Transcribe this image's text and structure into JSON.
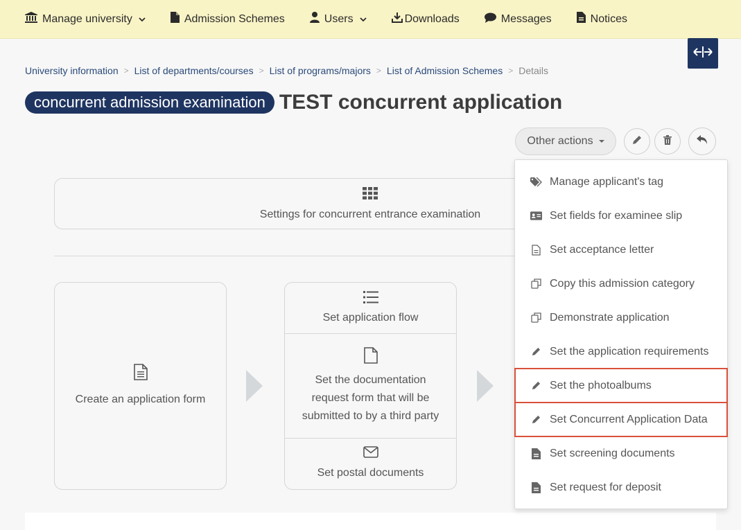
{
  "nav": {
    "manage_university": "Manage university",
    "admission_schemes": "Admission Schemes",
    "users": "Users",
    "downloads": "Downloads",
    "messages": "Messages",
    "notices": "Notices"
  },
  "breadcrumb": {
    "items": [
      "University information",
      "List of departments/courses",
      "List of programs/majors",
      "List of Admission Schemes"
    ],
    "current": "Details"
  },
  "header": {
    "badge": "concurrent admission examination",
    "title": "TEST concurrent application"
  },
  "actions": {
    "other_actions": "Other actions"
  },
  "settings": {
    "label": "Settings for concurrent entrance examination"
  },
  "cards": {
    "create_form": "Create an application form",
    "app_flow": "Set application flow",
    "doc_request": "Set the documentation request form that will be submitted to by a third party",
    "postal": "Set postal documents"
  },
  "dropdown": {
    "items": [
      {
        "label": "Manage applicant's tag",
        "icon": "tags-icon"
      },
      {
        "label": "Set fields for examinee slip",
        "icon": "id-card-icon"
      },
      {
        "label": "Set acceptance letter",
        "icon": "file-text-icon"
      },
      {
        "label": "Copy this admission category",
        "icon": "copy-icon"
      },
      {
        "label": "Demonstrate application",
        "icon": "copy-icon"
      },
      {
        "label": "Set the application requirements",
        "icon": "pencil-icon"
      },
      {
        "label": "Set the photoalbums",
        "icon": "pencil-icon"
      },
      {
        "label": "Set Concurrent Application Data",
        "icon": "pencil-icon"
      },
      {
        "label": "Set screening documents",
        "icon": "file-icon"
      },
      {
        "label": "Set request for deposit",
        "icon": "file-icon"
      }
    ]
  },
  "colors": {
    "nav_bg": "#f9f4c6",
    "accent_navy": "#1f3561",
    "highlight_red": "#d9503a"
  }
}
